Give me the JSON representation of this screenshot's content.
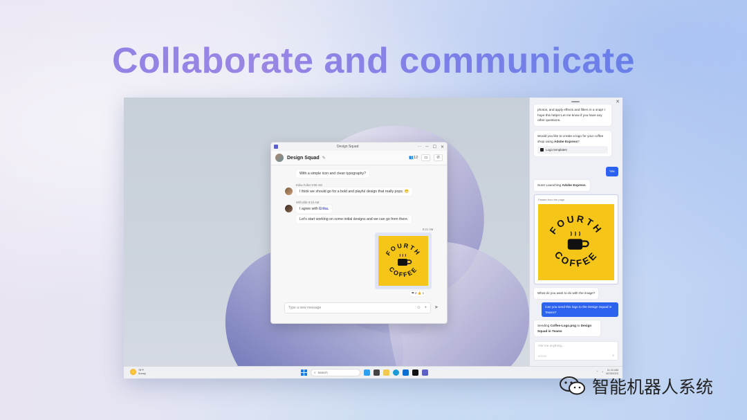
{
  "headline": "Collaborate and communicate",
  "chat_window": {
    "title": "Design Squad",
    "chat_name": "Design Squad",
    "participants_count": "12",
    "messages": [
      {
        "text": "With a simple icon and clean typography?"
      },
      {
        "author": "Erika Fuller",
        "time": "9:06 AM",
        "text": "I think we should go for a bold and playful design that really pops.",
        "emoji": "😁"
      },
      {
        "author": "Will Little",
        "time": "9:10 AM",
        "text_prefix": "I agree with",
        "mention": "Erika.",
        "text2": "Let's start working on some initial designs and we can go from there."
      },
      {
        "time": "9:21 AM",
        "image": "Fourth Coffee logo"
      }
    ],
    "reactions": "❤ 2   👍 1",
    "compose_placeholder": "Type a new message"
  },
  "logo": {
    "top": "FOURTH",
    "bottom": "COFFEE"
  },
  "copilot": {
    "messages": [
      {
        "role": "assistant",
        "text": "photos, and apply effects and filters in a snap! I hope this helps! Let me know if you have any other questions."
      },
      {
        "role": "assistant",
        "text_prefix": "Would you like to create a logo for your coffee shop using",
        "bold": "Adobe Express",
        "text_suffix": "?",
        "chip": "Logo templates"
      },
      {
        "role": "user",
        "text": "Yes"
      },
      {
        "role": "assistant",
        "text_prefix": "Sure! Launching",
        "bold": "Adobe Express",
        "text_suffix": "."
      },
      {
        "role": "assistant",
        "caption": "Pasted from the page"
      },
      {
        "role": "assistant",
        "text": "What do you want to do with the image?"
      },
      {
        "role": "user",
        "text": "Can you send this logo to the Design Squad in Teams?"
      },
      {
        "role": "assistant",
        "text_prefix": "Sending",
        "bold": "Coffee-Logo.png",
        "text_mid": "to",
        "bold2": "Design Squad in Teams"
      }
    ],
    "input_placeholder": "Ask me anything...",
    "input_count": "0/2000"
  },
  "taskbar": {
    "weather_temp": "78°F",
    "weather_cond": "Sunny",
    "search_placeholder": "Search",
    "time": "11:11 AM",
    "date": "5/23/2023"
  },
  "watermark": "智能机器人系统"
}
